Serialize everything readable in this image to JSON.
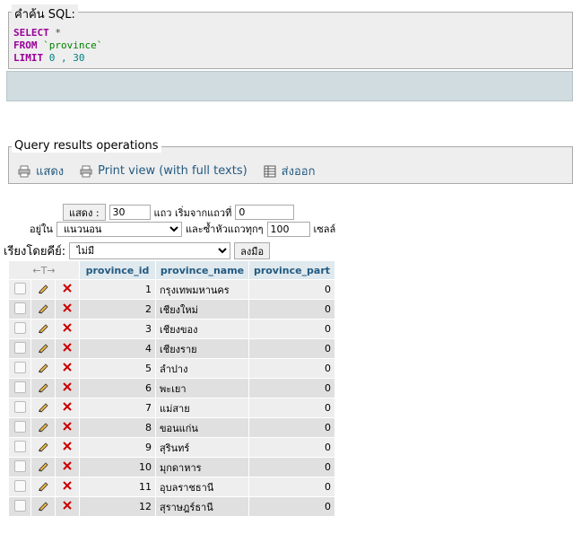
{
  "sql_panel": {
    "legend": "คำค้น SQL:",
    "line1_kw": "SELECT",
    "line1_rest": " *",
    "line2_kw": "FROM",
    "line2_rest": " `province`",
    "line3_kw": "LIMIT",
    "line3_rest": " 0 , 30"
  },
  "ops_panel": {
    "legend": "Query results operations",
    "items": [
      {
        "label": "แสดง",
        "icon": "print-icon"
      },
      {
        "label": "Print view (with full texts)",
        "icon": "print-icon"
      },
      {
        "label": "ส่งออก",
        "icon": "export-icon"
      }
    ]
  },
  "nav": {
    "show_button": "แสดง :",
    "rows_value": "30",
    "start_label": "แถว เริ่มจากแถวที่",
    "start_value": "0",
    "in_label": "อยู่ใน",
    "mode_value": "แนวนอน",
    "repeat_label": "และซ้ำหัวแถวทุกๆ",
    "repeat_value": "100",
    "cells_label": "เซลล์",
    "sort_label": "เรียงโดยคีย์:",
    "sort_value": "ไม่มี",
    "go_button": "ลงมือ"
  },
  "table": {
    "columns": [
      "province_id",
      "province_name",
      "province_part"
    ],
    "rows": [
      [
        "1",
        "กรุงเทพมหานคร",
        "0"
      ],
      [
        "2",
        "เชียงใหม่",
        "0"
      ],
      [
        "3",
        "เชียงของ",
        "0"
      ],
      [
        "4",
        "เชียงราย",
        "0"
      ],
      [
        "5",
        "ลำปาง",
        "0"
      ],
      [
        "6",
        "พะเยา",
        "0"
      ],
      [
        "7",
        "แม่สาย",
        "0"
      ],
      [
        "8",
        "ขอนแก่น",
        "0"
      ],
      [
        "9",
        "สุรินทร์",
        "0"
      ],
      [
        "10",
        "มุกดาหาร",
        "0"
      ],
      [
        "11",
        "อุบลราชธานี",
        "0"
      ],
      [
        "12",
        "สุราษฎร์ธานี",
        "0"
      ]
    ]
  },
  "colors": {
    "keyword": "#990099",
    "string": "#008000",
    "link": "#235a81",
    "delete": "#cc0000"
  }
}
